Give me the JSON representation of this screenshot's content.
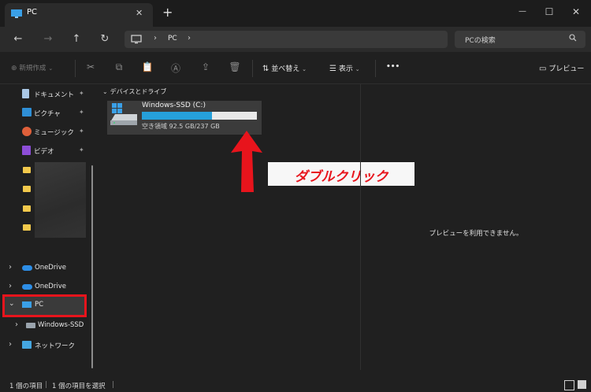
{
  "window": {
    "tab_title": "PC",
    "new_tab_glyph": "+",
    "close_tab_glyph": "✕",
    "minimize_glyph": "—",
    "maximize_glyph": "☐",
    "close_glyph": "✕"
  },
  "nav": {
    "back_glyph": "←",
    "forward_glyph": "→",
    "up_glyph": "↑",
    "refresh_glyph": "↻",
    "breadcrumb": [
      "PC"
    ],
    "search_placeholder": "PCの検索"
  },
  "toolbar": {
    "new_label": "新規作成",
    "sort_label": "並べ替え",
    "view_label": "表示",
    "more_label": "•••",
    "preview_label": "プレビュー"
  },
  "sidebar": {
    "quick_access": [
      {
        "label": "ドキュメント",
        "icon": "document-icon"
      },
      {
        "label": "ピクチャ",
        "icon": "pictures-icon"
      },
      {
        "label": "ミュージック",
        "icon": "music-icon"
      },
      {
        "label": "ビデオ",
        "icon": "video-icon"
      }
    ],
    "onedrive_1": "OneDrive",
    "onedrive_2": "OneDrive",
    "pc": "PC",
    "pc_child": "Windows-SSD",
    "network": "ネットワーク"
  },
  "main": {
    "group_header": "デバイスとドライブ",
    "drive": {
      "name": "Windows-SSD (C:)",
      "free_text": "空き領域 92.5 GB/237 GB",
      "used_fraction": 0.61
    },
    "annotation": "ダブルクリック"
  },
  "preview": {
    "message": "プレビューを利用できません。"
  },
  "status": {
    "items_count": "1 個の項目",
    "selected": "1 個の項目を選択"
  },
  "colors": {
    "accent": "#26a0da",
    "highlight_red": "#e8141c",
    "annotation_red": "#e8141c"
  }
}
